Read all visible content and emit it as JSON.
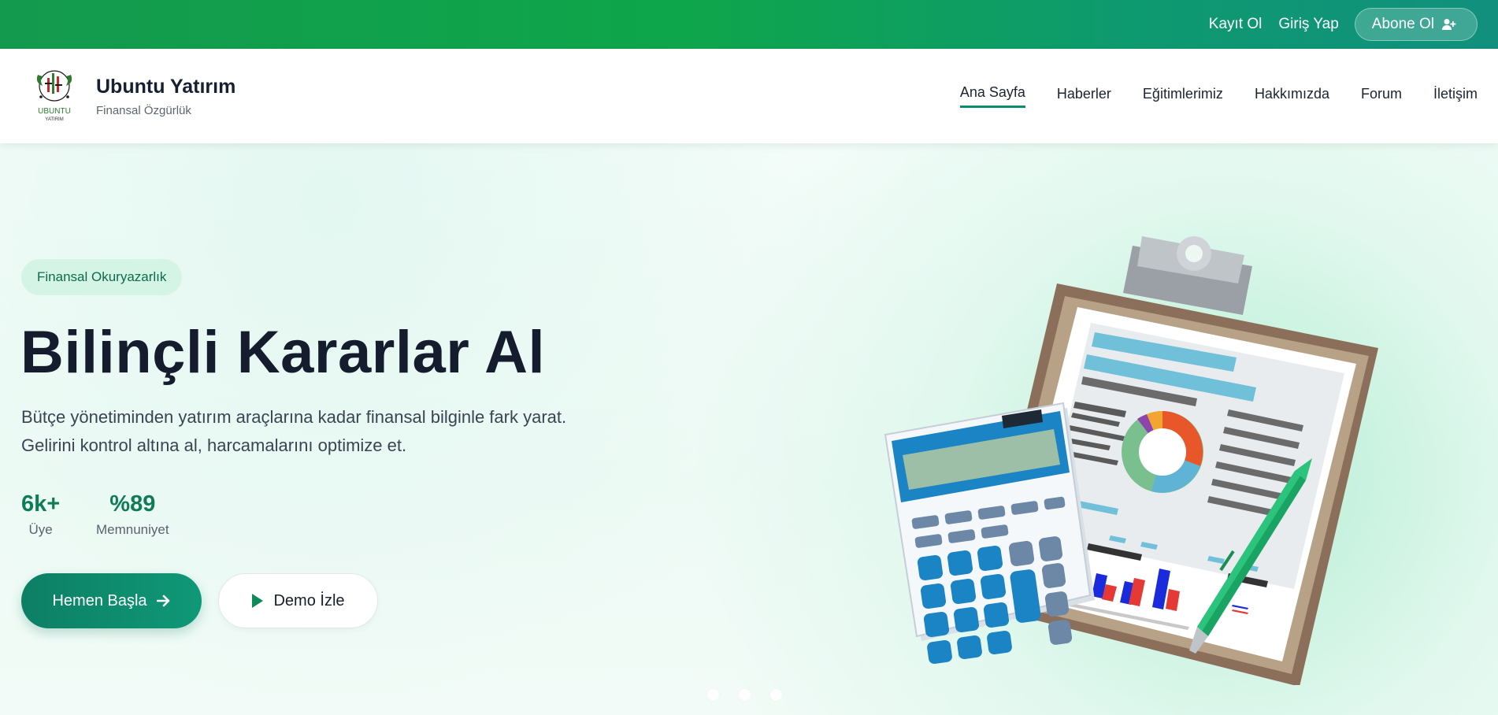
{
  "topbar": {
    "register_label": "Kayıt Ol",
    "login_label": "Giriş Yap",
    "subscribe_label": "Abone Ol",
    "subscribe_icon": "user-plus-icon"
  },
  "header": {
    "logo_text_main": "UBUNTU",
    "logo_text_sub": "YATIRIM",
    "brand_title": "Ubuntu Yatırım",
    "brand_subtitle": "Finansal Özgürlük",
    "nav": [
      {
        "label": "Ana Sayfa",
        "active": true
      },
      {
        "label": "Haberler",
        "active": false
      },
      {
        "label": "Eğitimlerimiz",
        "active": false
      },
      {
        "label": "Hakkımızda",
        "active": false
      },
      {
        "label": "Forum",
        "active": false
      },
      {
        "label": "İletişim",
        "active": false
      }
    ]
  },
  "hero": {
    "badge": "Finansal Okuryazarlık",
    "title": "Bilinçli Kararlar Al",
    "description": "Bütçe yönetiminden yatırım araçlarına kadar finansal bilginle fark yarat. Gelirini kontrol altına al, harcamalarını optimize et.",
    "stats": [
      {
        "value": "6k+",
        "label": "Üye"
      },
      {
        "value": "%89",
        "label": "Memnuniyet"
      }
    ],
    "primary_button": "Hemen Başla",
    "secondary_button": "Demo İzle",
    "slides": 3,
    "illustration": "calculator-clipboard-pen-illustration"
  },
  "colors": {
    "topbar_green": "#0ea64a",
    "brand_green": "#0f7c57",
    "primary_button": "#0d7f64",
    "badge_bg": "#d4f5e6",
    "title_dark": "#141c2d"
  }
}
